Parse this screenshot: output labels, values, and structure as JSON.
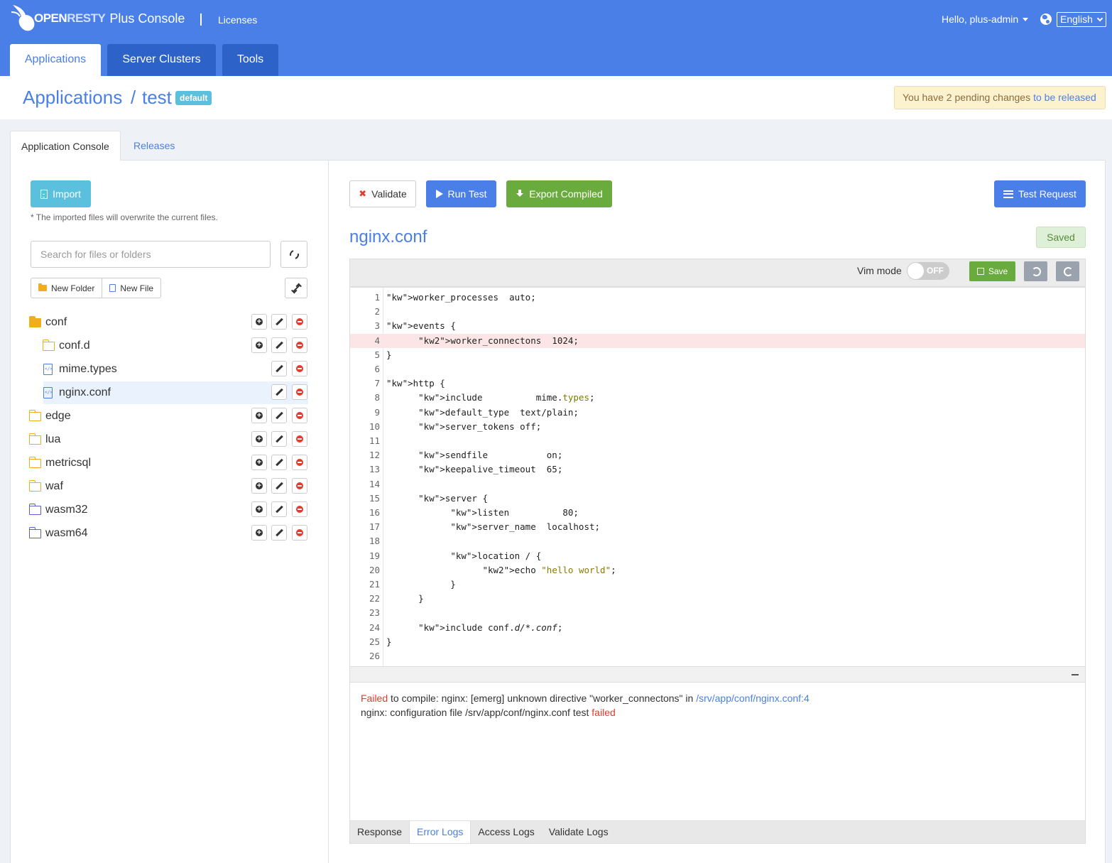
{
  "header": {
    "logo_text_1": "OPEN",
    "logo_text_2": "RESTY",
    "app_name": "Plus Console",
    "licenses_link": "Licenses",
    "user_greeting": "Hello, plus-admin",
    "language": "English",
    "tabs": [
      {
        "label": "Applications",
        "active": true
      },
      {
        "label": "Server Clusters",
        "active": false
      },
      {
        "label": "Tools",
        "active": false
      }
    ]
  },
  "page": {
    "breadcrumb_root": "Applications",
    "breadcrumb_separator": "/",
    "app_name": "test",
    "badge": "default",
    "pending_text": "You have 2 pending changes",
    "pending_link": "to be released"
  },
  "subtabs": [
    {
      "label": "Application Console",
      "active": true
    },
    {
      "label": "Releases",
      "active": false
    }
  ],
  "left": {
    "import_label": "Import",
    "import_note": "* The imported files will overwrite the current files.",
    "search_placeholder": "Search for files or folders",
    "new_folder_label": "New Folder",
    "new_file_label": "New File",
    "tree": [
      {
        "name": "conf",
        "type": "folder-open"
      },
      {
        "name": "conf.d",
        "type": "folder"
      },
      {
        "name": "mime.types",
        "type": "file"
      },
      {
        "name": "nginx.conf",
        "type": "file",
        "selected": true
      },
      {
        "name": "edge",
        "type": "folder"
      },
      {
        "name": "lua",
        "type": "folder"
      },
      {
        "name": "metricsql",
        "type": "folder"
      },
      {
        "name": "waf",
        "type": "folder"
      },
      {
        "name": "wasm32",
        "type": "folder-purple"
      },
      {
        "name": "wasm64",
        "type": "folder-purple"
      }
    ]
  },
  "right": {
    "validate_label": "Validate",
    "run_test_label": "Run Test",
    "export_label": "Export Compiled",
    "test_request_label": "Test Request",
    "file_title": "nginx.conf",
    "saved_label": "Saved",
    "vim_mode_label": "Vim mode",
    "vim_toggle": "OFF",
    "save_label": "Save",
    "error_line": 4,
    "code_lines": [
      "worker_processes  auto;",
      "",
      "events {",
      "      worker_connectons  1024;",
      "}",
      "",
      "http {",
      "      include          mime.types;",
      "      default_type  text/plain;",
      "      server_tokens off;",
      "",
      "      sendfile           on;",
      "      keepalive_timeout  65;",
      "",
      "      server {",
      "            listen          80;",
      "            server_name  localhost;",
      "",
      "            location / {",
      "                  echo \"hello world\";",
      "            }",
      "      }",
      "",
      "      include conf.d/*.conf;",
      "}",
      ""
    ],
    "log": {
      "line1_status": "Failed",
      "line1_text": " to compile: nginx: [emerg] unknown directive \"worker_connectons\" in ",
      "line1_path": "/srv/app/conf/nginx.conf:4",
      "line2_text": "nginx: configuration file /srv/app/conf/nginx.conf test ",
      "line2_status": "failed"
    },
    "log_tabs": [
      {
        "label": "Response",
        "active": false
      },
      {
        "label": "Error Logs",
        "active": true
      },
      {
        "label": "Access Logs",
        "active": false
      },
      {
        "label": "Validate Logs",
        "active": false
      }
    ]
  }
}
